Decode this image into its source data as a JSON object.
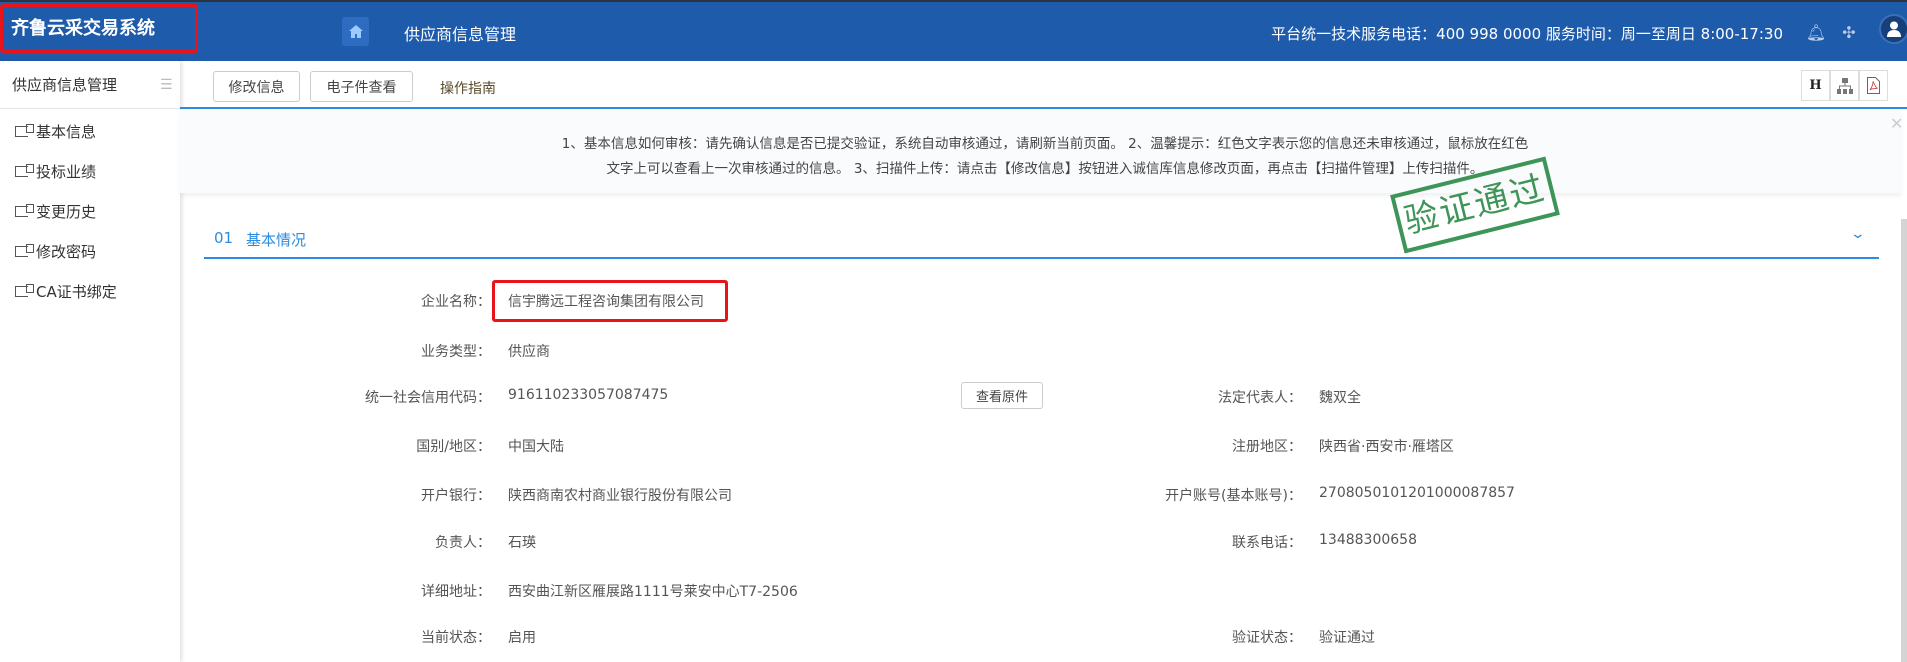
{
  "header": {
    "app_title": "齐鲁云采交易系统",
    "page_title": "供应商信息管理",
    "service_info": "平台统一技术服务电话：400 998 0000 服务时间：周一至周日 8:00-17:30",
    "brand_color": "#1f5bab",
    "icons": [
      "home-icon",
      "bell-icon",
      "collapse-icon",
      "user-avatar-icon"
    ]
  },
  "sidebar": {
    "title": "供应商信息管理",
    "items": [
      {
        "label": "基本信息"
      },
      {
        "label": "投标业绩"
      },
      {
        "label": "变更历史"
      },
      {
        "label": "修改密码"
      },
      {
        "label": "CA证书绑定"
      }
    ]
  },
  "toolbar": {
    "edit_label": "修改信息",
    "efiles_label": "电子件查看",
    "guide_label": "操作指南",
    "right_icons": [
      "history-icon",
      "org-chart-icon",
      "pdf-icon"
    ]
  },
  "notice": {
    "line1": "1、基本信息如何审核：请先确认信息是否已提交验证，系统自动审核通过，请刷新当前页面。 2、温馨提示：红色文字表示您的信息还未审核通过，鼠标放在红色",
    "line2": "文字上可以查看上一次审核通过的信息。 3、扫描件上传：请点击【修改信息】按钮进入诚信库信息修改页面，再点击【扫描件管理】上传扫描件。"
  },
  "stamp": "验证通过",
  "section": {
    "number": "01",
    "title": "基本情况"
  },
  "fields": {
    "company_name": {
      "label": "企业名称：",
      "value": "信宇腾远工程咨询集团有限公司"
    },
    "business_type": {
      "label": "业务类型：",
      "value": "供应商"
    },
    "credit_code": {
      "label": "统一社会信用代码：",
      "value": "916110233057087475",
      "button": "查看原件"
    },
    "legal_rep": {
      "label": "法定代表人：",
      "value": "魏双全"
    },
    "country": {
      "label": "国别/地区：",
      "value": "中国大陆"
    },
    "reg_area": {
      "label": "注册地区：",
      "value": "陕西省·西安市·雁塔区"
    },
    "bank": {
      "label": "开户银行：",
      "value": "陕西商南农村商业银行股份有限公司"
    },
    "account": {
      "label": "开户账号(基本账号)：",
      "value": "2708050101201000087857"
    },
    "manager": {
      "label": "负责人：",
      "value": "石瑛"
    },
    "phone": {
      "label": "联系电话：",
      "value": "13488300658"
    },
    "address": {
      "label": "详细地址：",
      "value": "西安曲江新区雁展路1111号莱安中心T7-2506"
    },
    "status": {
      "label": "当前状态：",
      "value": "启用"
    },
    "verify": {
      "label": "验证状态：",
      "value": "验证通过"
    }
  }
}
